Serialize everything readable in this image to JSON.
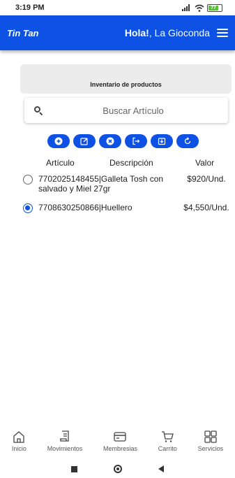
{
  "status_bar": {
    "time": "3:19 PM",
    "battery": "77"
  },
  "header": {
    "brand": "Tin Tan",
    "greeting_bold": "Hola!",
    "user_name": "La Gioconda"
  },
  "page": {
    "title": "Inventario de productos"
  },
  "search": {
    "placeholder": "Buscar Artículo",
    "value": ""
  },
  "toolbar": {
    "buttons": [
      {
        "icon": "add-circle-icon"
      },
      {
        "icon": "edit-icon"
      },
      {
        "icon": "delete-circle-icon"
      },
      {
        "icon": "export-icon"
      },
      {
        "icon": "download-icon"
      },
      {
        "icon": "refresh-icon"
      }
    ]
  },
  "table": {
    "headers": {
      "articulo": "Artículo",
      "descripcion": "Descripción",
      "valor": "Valor"
    },
    "rows": [
      {
        "text": "7702025148455|Galleta Tosh con salvado y Miel 27gr",
        "price": "$920/Und.",
        "selected": false
      },
      {
        "text": "7708630250866|Huellero",
        "price": "$4,550/Und.",
        "selected": true
      }
    ]
  },
  "bottom_nav": {
    "items": [
      {
        "label": "Inicio",
        "icon": "home-icon"
      },
      {
        "label": "Movimientos",
        "icon": "receipt-icon"
      },
      {
        "label": "Membresias",
        "icon": "card-icon"
      },
      {
        "label": "Carrito",
        "icon": "cart-icon"
      },
      {
        "label": "Servicios",
        "icon": "grid-icon"
      }
    ]
  },
  "colors": {
    "primary": "#0d52e4",
    "card_bg": "#ececec"
  }
}
